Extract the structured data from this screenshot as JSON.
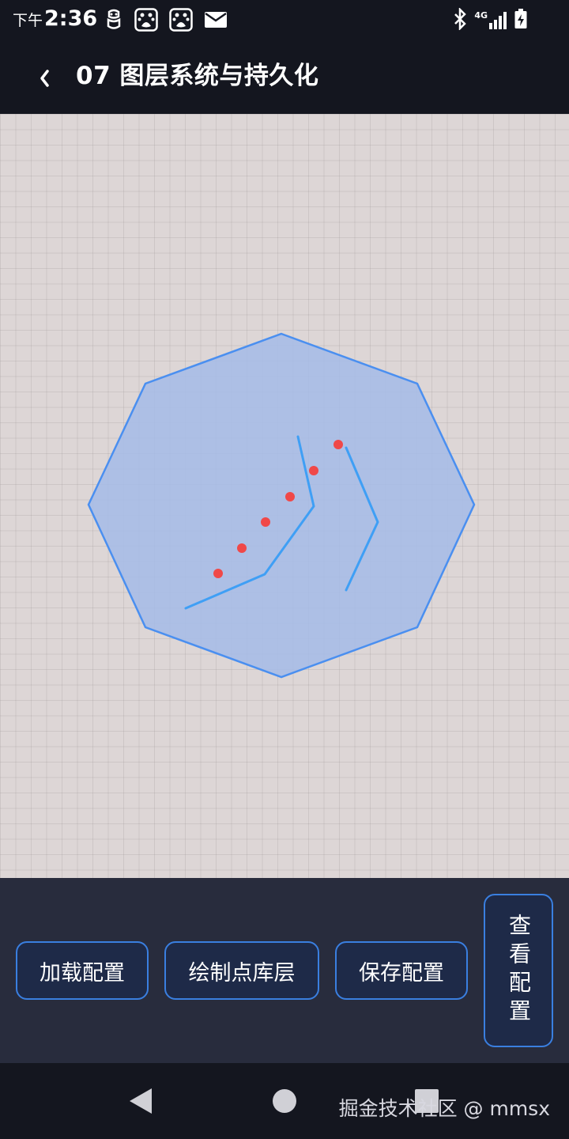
{
  "status_bar": {
    "time_prefix": "下午",
    "time": "2:36",
    "left_icons": [
      "robot-icon",
      "baidu-paw-icon",
      "baidu-paw-icon",
      "mail-icon"
    ],
    "right_icons": [
      "bluetooth-icon",
      "4g-signal-icon",
      "battery-charging-icon"
    ],
    "network_label": "4G"
  },
  "app_bar": {
    "back_icon": "chevron-left-icon",
    "title": "07 图层系统与持久化"
  },
  "canvas": {
    "fill_color": "#a4bbe8",
    "stroke_color": "#4a8ff0",
    "line_color": "#3f9ff5",
    "point_color": "#f04848",
    "background_color": "#ddd6d6"
  },
  "toolbar": {
    "load_config_label": "加载配置",
    "draw_points_label": "绘制点库层",
    "save_config_label": "保存配置",
    "view_config_label": "查看配置",
    "button_border_color": "#3a7fe0",
    "button_bg_color": "#1e2a48"
  },
  "nav_bar": {
    "icons": [
      "nav-back-icon",
      "nav-home-icon",
      "nav-recent-icon"
    ]
  },
  "watermark": {
    "text": "掘金技术社区 @ mmsx"
  }
}
